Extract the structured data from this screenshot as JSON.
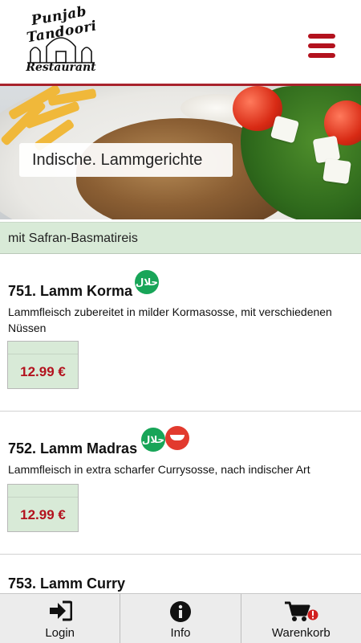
{
  "header": {
    "logo_title": "Punjab Tandoori",
    "logo_subtitle": "Restaurant"
  },
  "hero": {
    "label": "Indische. Lammgerichte"
  },
  "section": {
    "title": "mit Safran-Basmatireis"
  },
  "items": [
    {
      "title": "751. Lamm Korma",
      "description": "Lammfleisch zubereitet in milder Kormasosse, mit verschiedenen Nüssen",
      "price": "12.99 €",
      "badges": [
        "halal"
      ]
    },
    {
      "title": "752. Lamm Madras",
      "description": "Lammfleisch in extra scharfer Currysosse, nach indischer Art",
      "price": "12.99 €",
      "badges": [
        "halal",
        "spicy"
      ]
    },
    {
      "title": "753. Lamm Curry"
    }
  ],
  "badge_text": {
    "halal": "حلال"
  },
  "bottom_nav": {
    "login": "Login",
    "info": "Info",
    "cart": "Warenkorb"
  },
  "colors": {
    "accent_red": "#b3121e",
    "section_green": "#d8ead7",
    "halal_green": "#18a558",
    "spicy_red": "#e23a2e"
  },
  "icons": {
    "menu": "hamburger-menu-icon",
    "login": "login-arrow-icon",
    "info": "info-circle-icon",
    "cart": "shopping-cart-icon",
    "halal": "halal-badge-icon",
    "spicy": "chili-pepper-icon"
  }
}
